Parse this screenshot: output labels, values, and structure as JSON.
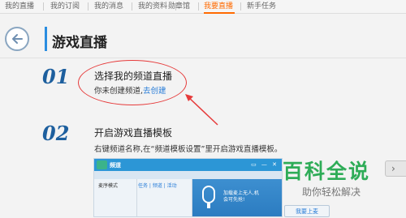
{
  "nav": {
    "items": [
      {
        "label": "我的直播",
        "active": false
      },
      {
        "label": "我的订阅",
        "active": false
      },
      {
        "label": "我的消息",
        "active": false
      },
      {
        "label": "我的资料",
        "active": false
      },
      {
        "label": "勋章馆",
        "active": false
      },
      {
        "label": "我要直播",
        "active": true
      },
      {
        "label": "新手任务",
        "active": false
      }
    ],
    "active_color": "#ff6a00"
  },
  "header": {
    "title": "游戏直播",
    "back_icon": "arrow-left-icon",
    "accent_color": "#2a8de0"
  },
  "steps": [
    {
      "number": "01",
      "title": "选择我的频道直播",
      "text_prefix": "你未创建频道,",
      "link": "去创建"
    },
    {
      "number": "02",
      "title": "开启游戏直播模板",
      "text": "右键频道名称,在“频道模板设置”里开启游戏直播模板。"
    }
  ],
  "annotation": {
    "color": "#e63a3a",
    "shape": "ellipse-with-arrow"
  },
  "screenshot_preview": {
    "logo_text": "频道",
    "mode_label": "麦序模式",
    "menu_text": "任务 | 频道 | 活动",
    "message_lines": [
      "加载麦上无人,机",
      "会可先抢!"
    ],
    "icons": [
      "mic-icon",
      "window-controls-icon"
    ],
    "button_label": "我要上麦"
  },
  "watermark": {
    "title": "百科全说",
    "subtitle": "助你轻松解决",
    "color": "#2eac57"
  },
  "edge_tab": {
    "icon": "chevron-icon"
  }
}
